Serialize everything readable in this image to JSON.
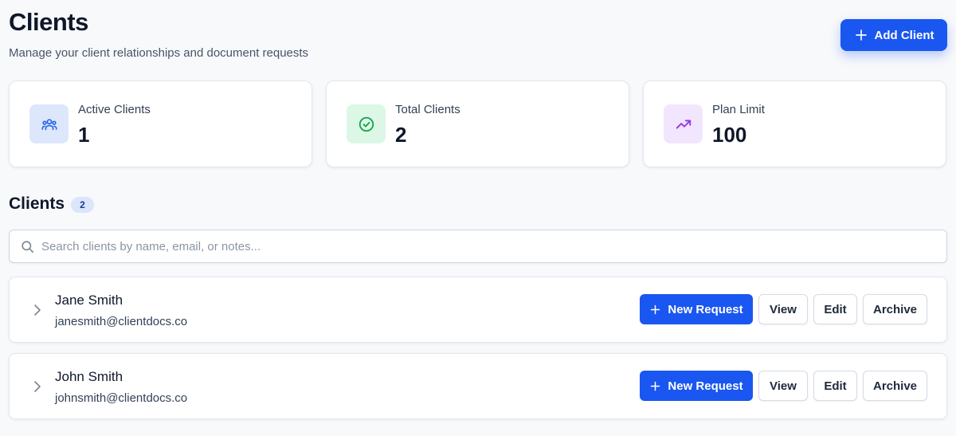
{
  "header": {
    "title": "Clients",
    "subtitle": "Manage your client relationships and document requests",
    "add_button_label": "Add Client"
  },
  "stats": [
    {
      "label": "Active Clients",
      "value": "1",
      "icon": "users-icon",
      "color": "#2563eb",
      "bg": "#dde7fb"
    },
    {
      "label": "Total Clients",
      "value": "2",
      "icon": "check-circle-icon",
      "color": "#16a34a",
      "bg": "#dcf7e6"
    },
    {
      "label": "Plan Limit",
      "value": "100",
      "icon": "trending-up-icon",
      "color": "#9333ea",
      "bg": "#f1e6fd"
    }
  ],
  "clients_section": {
    "title": "Clients",
    "count": "2"
  },
  "search": {
    "placeholder": "Search clients by name, email, or notes...",
    "value": ""
  },
  "clients": [
    {
      "name": "Jane Smith",
      "email": "janesmith@clientdocs.co"
    },
    {
      "name": "John Smith",
      "email": "johnsmith@clientdocs.co"
    }
  ],
  "row_actions": {
    "new_request": "New Request",
    "view": "View",
    "edit": "Edit",
    "archive": "Archive"
  },
  "colors": {
    "accent": "#1a56f0",
    "background": "#f8f9fb"
  }
}
